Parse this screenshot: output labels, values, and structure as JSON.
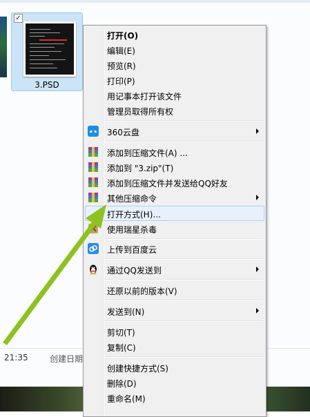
{
  "explorer": {
    "file": {
      "name": "3.PSD",
      "checked": true
    },
    "status": {
      "time": "21:35",
      "created_label": "创建日期"
    }
  },
  "context_menu": {
    "items": [
      {
        "label": "打开(O)",
        "bold": true
      },
      {
        "label": "编辑(E)"
      },
      {
        "label": "预览(R)"
      },
      {
        "label": "打印(P)"
      },
      {
        "label": "用记事本打开该文件"
      },
      {
        "label": "管理员取得所有权"
      },
      {
        "label": "360云盘",
        "icon": "360-cloud-icon",
        "submenu": true
      },
      {
        "label": "添加到压缩文件(A) ...",
        "icon": "winrar-icon"
      },
      {
        "label": "添加到 \"3.zip\"(T)",
        "icon": "winrar-icon"
      },
      {
        "label": "添加到压缩文件并发送给QQ好友",
        "icon": "winrar-icon"
      },
      {
        "label": "其他压缩命令",
        "icon": "winrar-icon",
        "submenu": true
      },
      {
        "label": "打开方式(H)...",
        "highlighted": true
      },
      {
        "label": "使用瑞星杀毒",
        "icon": "rising-antivirus-icon"
      },
      {
        "label": "上传到百度云",
        "icon": "baidu-cloud-icon"
      },
      {
        "label": "通过QQ发送到",
        "icon": "qq-penguin-icon",
        "submenu": true
      },
      {
        "label": "还原以前的版本(V)"
      },
      {
        "label": "发送到(N)",
        "submenu": true
      },
      {
        "label": "剪切(T)"
      },
      {
        "label": "复制(C)"
      },
      {
        "label": "创建快捷方式(S)"
      },
      {
        "label": "删除(D)"
      },
      {
        "label": "重命名(M)"
      }
    ]
  },
  "annotation": {
    "color": "#8dc21f"
  }
}
